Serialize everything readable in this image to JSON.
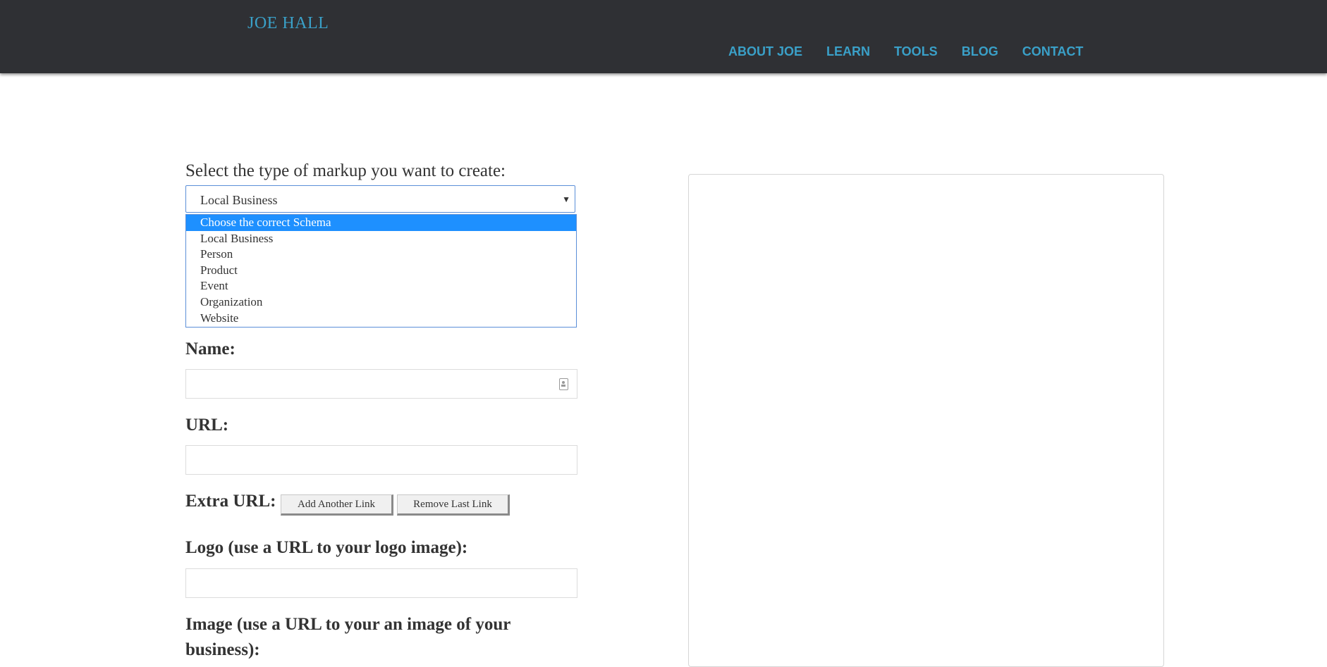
{
  "header": {
    "brand": "JOE HALL",
    "nav": [
      {
        "label": "ABOUT JOE"
      },
      {
        "label": "LEARN"
      },
      {
        "label": "TOOLS"
      },
      {
        "label": "BLOG"
      },
      {
        "label": "CONTACT"
      }
    ]
  },
  "form": {
    "select_label": "Select the type of markup you want to create:",
    "select_value": "Local Business",
    "options": [
      "Choose the correct Schema",
      "Local Business",
      "Person",
      "Product",
      "Event",
      "Organization",
      "Website"
    ],
    "name_label": "Name:",
    "url_label": "URL:",
    "extra_url_label": "Extra URL:",
    "add_link_button": "Add Another Link",
    "remove_link_button": "Remove Last Link",
    "logo_label": "Logo (use a URL to your logo image):",
    "image_label_line1": "Image (use a URL to your an image of your",
    "image_label_line2": "business):"
  },
  "colors": {
    "header_bg": "#2f3034",
    "accent": "#3aa0c8",
    "dropdown_highlight": "#1e90ff"
  }
}
